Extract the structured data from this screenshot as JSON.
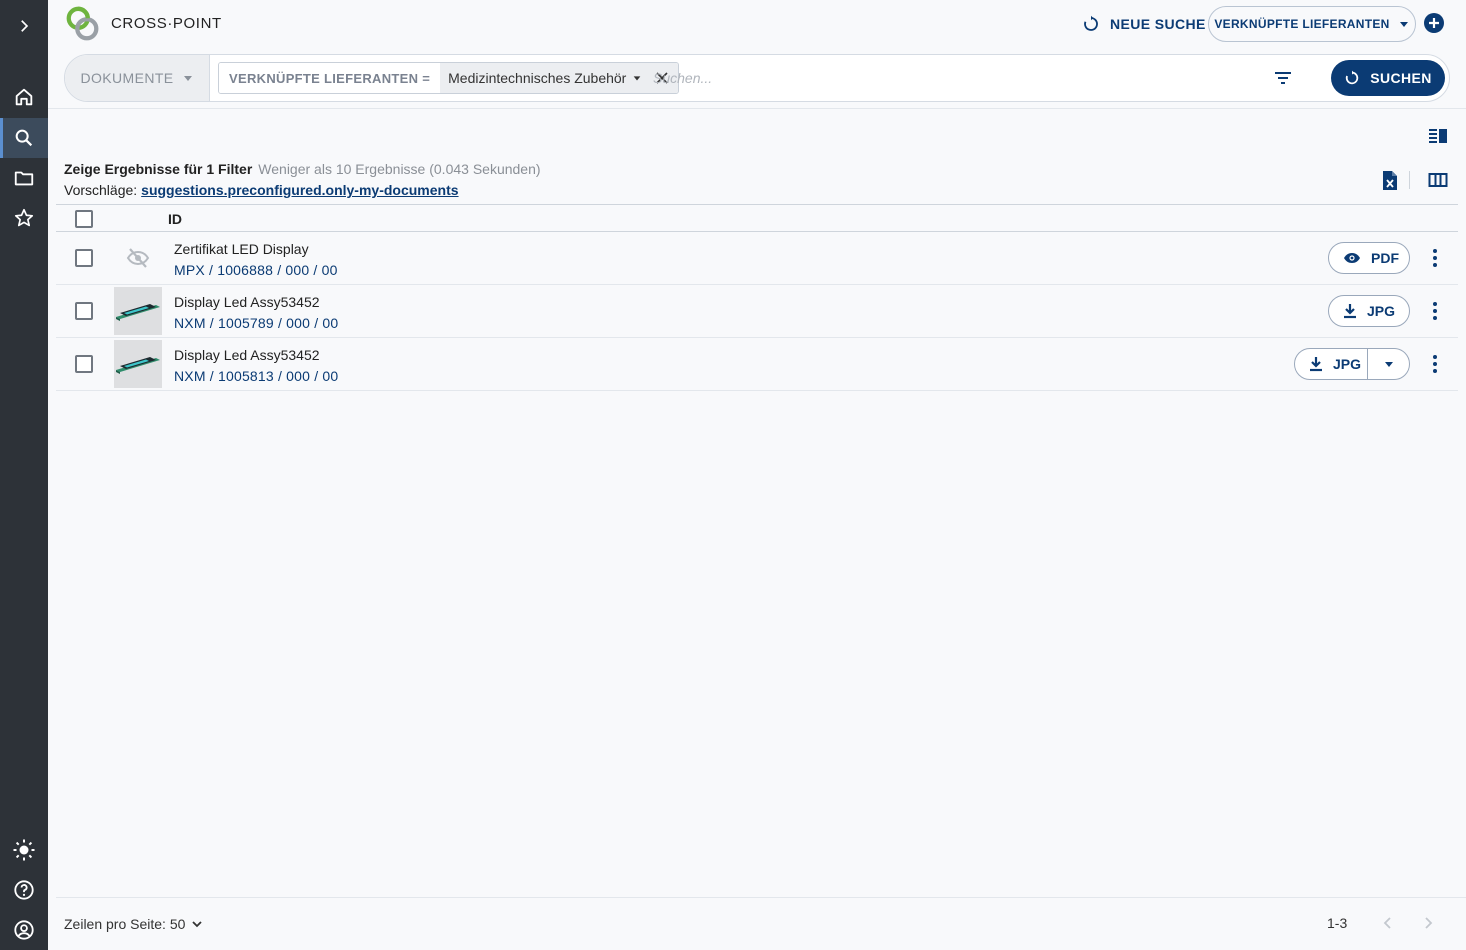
{
  "app": {
    "title": "CROSS·POINT"
  },
  "header": {
    "new_search_label": "NEUE SUCHE",
    "linked_suppliers_label": "VERKNÜPFTE LIEFERANTEN"
  },
  "search": {
    "doc_type": "DOKUMENTE",
    "filter_key": "VERKNÜPFTE LIEFERANTEN =",
    "filter_value": "Medizintechnisches Zubehör",
    "placeholder": "Suchen...",
    "button_label": "SUCHEN"
  },
  "results": {
    "summary_label": "Zeige Ergebnisse für 1 Filter",
    "summary_detail": "Weniger als 10 Ergebnisse (0.043 Sekunden)",
    "suggestions_label": "Vorschläge:",
    "suggestion_link": "suggestions.preconfigured.only-my-documents"
  },
  "table": {
    "header_id": "ID",
    "rows": [
      {
        "title": "Zertifikat LED Display",
        "id": "MPX / 1006888 / 000 / 00",
        "action": "PDF",
        "action_icon": "eye-icon",
        "thumbnail": "hidden-icon"
      },
      {
        "title": "Display Led Assy53452",
        "id": "NXM / 1005789 / 000 / 00",
        "action": "JPG",
        "action_icon": "download-icon",
        "thumbnail": "led-display-image"
      },
      {
        "title": "Display Led Assy53452",
        "id": "NXM / 1005813 / 000 / 00",
        "action": "JPG",
        "action_icon": "download-icon",
        "thumbnail": "led-display-image",
        "split": true
      }
    ]
  },
  "footer": {
    "rows_per_page": "Zeilen pro Seite: 50",
    "range": "1-3"
  },
  "colors": {
    "primary": "#0b3b74",
    "sidebar": "#2d3238",
    "sidebar_active": "#3c4b5c"
  }
}
